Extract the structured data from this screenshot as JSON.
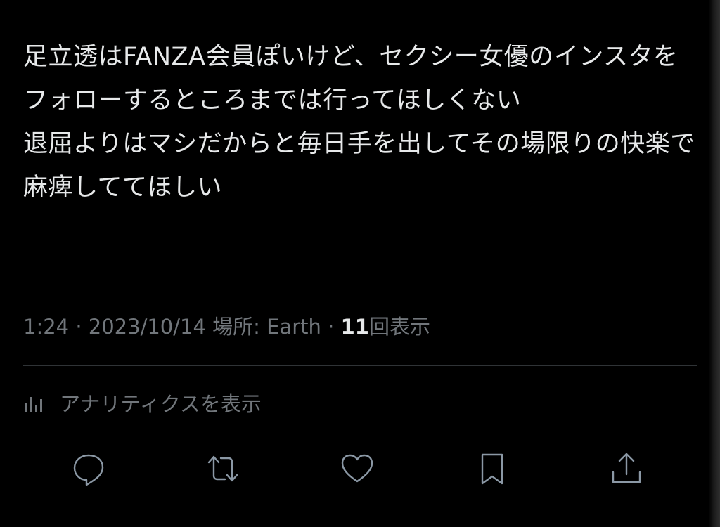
{
  "tweet": {
    "text": "足立透はFANZA会員ぽいけど、セクシー女優のインスタをフォローするところまでは行ってほしくない\n退屈よりはマシだからと毎日手を出してその場限りの快楽で麻痺しててほしい"
  },
  "meta": {
    "time": "1:24",
    "sep1": " · ",
    "date": "2023/10/14",
    "location_label": " 場所: ",
    "location": "Earth",
    "sep2": " · ",
    "views_count": "11",
    "views_label": "回表示"
  },
  "analytics": {
    "icon": "bar-chart-icon",
    "label": "アナリティクスを表示"
  },
  "actions": {
    "reply_icon": "reply-icon",
    "retweet_icon": "retweet-icon",
    "like_icon": "heart-icon",
    "bookmark_icon": "bookmark-icon",
    "share_icon": "share-icon"
  },
  "colors": {
    "background": "#000000",
    "text": "#e7e9ea",
    "secondary": "#71767b",
    "divider": "#2f3336"
  }
}
